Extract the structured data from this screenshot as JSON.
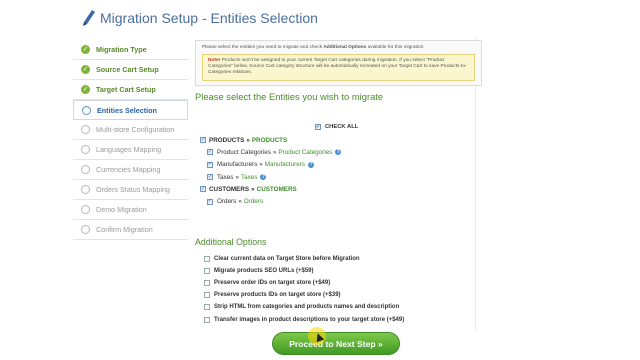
{
  "header": {
    "title": "Migration Setup - Entities Selection",
    "icon": "pen-icon"
  },
  "sidebar": {
    "steps": [
      {
        "label": "Migration Type",
        "state": "done"
      },
      {
        "label": "Source Cart Setup",
        "state": "done"
      },
      {
        "label": "Target Cart Setup",
        "state": "done"
      },
      {
        "label": "Entities Selection",
        "state": "active"
      },
      {
        "label": "Multi-store Configuration",
        "state": "pending"
      },
      {
        "label": "Languages Mapping",
        "state": "pending"
      },
      {
        "label": "Currencies Mapping",
        "state": "pending"
      },
      {
        "label": "Orders Status Mapping",
        "state": "pending"
      },
      {
        "label": "Demo Migration",
        "state": "pending"
      },
      {
        "label": "Confirm Migration",
        "state": "pending"
      }
    ]
  },
  "content": {
    "info_text_1": "Please select the entities you need to migrate and check ",
    "info_text_bold": "Additional Options",
    "info_text_2": " available for this migration.",
    "note_label": "Note!",
    "note_text": " Products won't be assigned to your current Target Cart categories during migration. If you select \"Product Categories\" below, Source Cart category structure will be automatically recreated on your Target Cart to save Products-to-Categories relations.",
    "section_title": "Please select the Entities you wish to migrate",
    "check_all_label": "CHECK ALL",
    "arrow": "»",
    "entities": [
      {
        "source": "PRODUCTS",
        "target": "PRODUCTS",
        "level": "parent",
        "checked": true,
        "help": false
      },
      {
        "source": "Product Categories",
        "target": "Product Categories",
        "level": "child",
        "checked": true,
        "help": true
      },
      {
        "source": "Manufacturers",
        "target": "Manufacturers",
        "level": "child",
        "checked": true,
        "help": true
      },
      {
        "source": "Taxes",
        "target": "Taxes",
        "level": "child",
        "checked": true,
        "help": true
      },
      {
        "source": "CUSTOMERS",
        "target": "CUSTOMERS",
        "level": "parent",
        "checked": true,
        "help": false
      },
      {
        "source": "Orders",
        "target": "Orders",
        "level": "child",
        "checked": true,
        "help": false
      }
    ],
    "additional_title": "Additional Options",
    "options": [
      {
        "label": "Clear current data on Target Store before Migration",
        "checked": false
      },
      {
        "label": "Migrate products SEO URLs (+$59)",
        "checked": false
      },
      {
        "label": "Preserve order IDs on target store (+$49)",
        "checked": false
      },
      {
        "label": "Preserve products IDs on target store (+$39)",
        "checked": false
      },
      {
        "label": "Strip HTML from categories and products names and description",
        "checked": false
      },
      {
        "label": "Transfer images in product descriptions to your target store (+$49)",
        "checked": false
      }
    ],
    "proceed_label": "Proceed to Next Step »"
  },
  "colors": {
    "accent_blue": "#4a6f9e",
    "accent_green": "#4a8c2a",
    "button_green": "#3f9a23",
    "note_bg": "#fcf6cf"
  }
}
